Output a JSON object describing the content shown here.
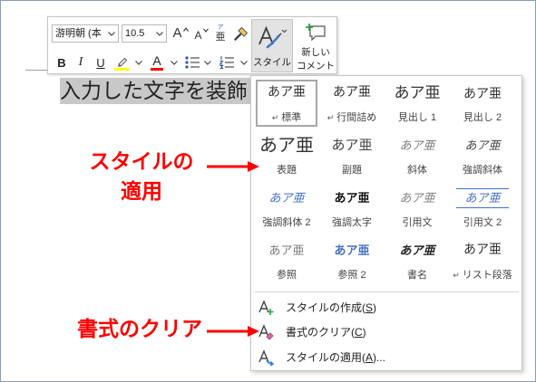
{
  "toolbar": {
    "font_name": "游明朝 (本",
    "font_size": "10.5",
    "grow_font": "A",
    "shrink_font": "A",
    "phonetic_ruby": "ア",
    "phonetic_base": "亜",
    "styles_label": "スタイル",
    "new_comment": [
      "新しい",
      "コメント"
    ],
    "bold": "B",
    "italic": "I",
    "underline": "U",
    "font_color_letter": "A",
    "highlight_color": "#ffff00",
    "font_color": "#ff0000"
  },
  "document": {
    "selected_text": "入力した文字を装飾"
  },
  "style_gallery": {
    "accent_color": "#4472c4",
    "items": [
      {
        "sample": "あア亜",
        "mark": "↵",
        "label": "標準",
        "selected": true
      },
      {
        "sample": "あア亜",
        "mark": "↵",
        "label": "行間詰め"
      },
      {
        "sample": "あア亜",
        "label": "見出し 1"
      },
      {
        "sample": "あア亜",
        "label": "見出し 2"
      },
      {
        "sample": "あア亜",
        "label": "表題"
      },
      {
        "sample": "あア亜",
        "label": "副題"
      },
      {
        "sample": "あア亜",
        "label": "斜体"
      },
      {
        "sample": "あア亜",
        "label": "強調斜体"
      },
      {
        "sample": "あア亜",
        "label": "強調斜体 2"
      },
      {
        "sample": "あア亜",
        "label": "強調太字"
      },
      {
        "sample": "あア亜",
        "label": "引用文"
      },
      {
        "sample": "あア亜",
        "label": "引用文 2"
      },
      {
        "sample": "あア亜",
        "label": "参照"
      },
      {
        "sample": "あア亜",
        "label": "参照 2"
      },
      {
        "sample": "あア亜",
        "label": "書名"
      },
      {
        "sample": "あア亜",
        "mark": "↵",
        "label": "リスト段落"
      }
    ]
  },
  "menu": {
    "items": [
      {
        "before": "スタイルの作成(",
        "key": "S",
        "after": ")",
        "icon": "new-style-icon"
      },
      {
        "before": "書式のクリア(",
        "key": "C",
        "after": ")",
        "icon": "clear-formatting-icon"
      },
      {
        "before": "スタイルの適用(",
        "key": "A",
        "after": ")...",
        "icon": "apply-styles-icon"
      }
    ]
  },
  "annotations": {
    "color": "#ff0000",
    "styles_callout": [
      "スタイルの",
      "適用"
    ],
    "clear_callout": "書式のクリア"
  }
}
